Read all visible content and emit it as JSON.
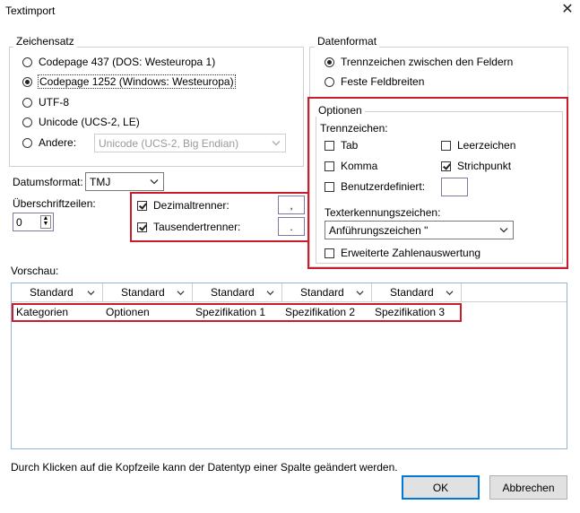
{
  "window": {
    "title": "Textimport"
  },
  "charset": {
    "legend": "Zeichensatz",
    "options": [
      {
        "label": "Codepage 437 (DOS: Westeuropa 1)",
        "checked": false
      },
      {
        "label": "Codepage 1252 (Windows: Westeuropa)",
        "checked": true
      },
      {
        "label": "UTF-8",
        "checked": false
      },
      {
        "label": "Unicode (UCS-2, LE)",
        "checked": false
      },
      {
        "label": "Andere:",
        "checked": false
      }
    ],
    "other_value": "Unicode (UCS-2, Big Endian)"
  },
  "date_format": {
    "label": "Datumsformat:",
    "value": "TMJ"
  },
  "header_rows": {
    "label": "Überschriftzeilen:",
    "value": "0"
  },
  "decimal": {
    "label": "Dezimaltrenner:",
    "value": ",",
    "checked": true
  },
  "thousands": {
    "label": "Tausendertrenner:",
    "value": ".",
    "checked": true
  },
  "data_format": {
    "legend": "Datenformat",
    "options": [
      {
        "label": "Trennzeichen zwischen den Feldern",
        "checked": true
      },
      {
        "label": "Feste Feldbreiten",
        "checked": false
      }
    ]
  },
  "options": {
    "legend": "Optionen",
    "separators_label": "Trennzeichen:",
    "tab": {
      "label": "Tab",
      "checked": false
    },
    "space": {
      "label": "Leerzeichen",
      "checked": false
    },
    "comma": {
      "label": "Komma",
      "checked": false
    },
    "semicolon": {
      "label": "Strichpunkt",
      "checked": true
    },
    "custom": {
      "label": "Benutzerdefiniert:",
      "checked": false,
      "value": ""
    },
    "text_qualifier_label": "Texterkennungszeichen:",
    "text_qualifier_value": "Anführungszeichen \"",
    "extended": {
      "label": "Erweiterte Zahlenauswertung",
      "checked": false
    }
  },
  "preview": {
    "label": "Vorschau:",
    "columns": [
      "Standard",
      "Standard",
      "Standard",
      "Standard",
      "Standard"
    ],
    "row": [
      "Kategorien",
      "Optionen",
      "Spezifikation 1",
      "Spezifikation 2",
      "Spezifikation 3"
    ]
  },
  "hint": "Durch Klicken auf die Kopfzeile kann der Datentyp einer Spalte geändert werden.",
  "buttons": {
    "ok": "OK",
    "cancel": "Abbrechen"
  }
}
